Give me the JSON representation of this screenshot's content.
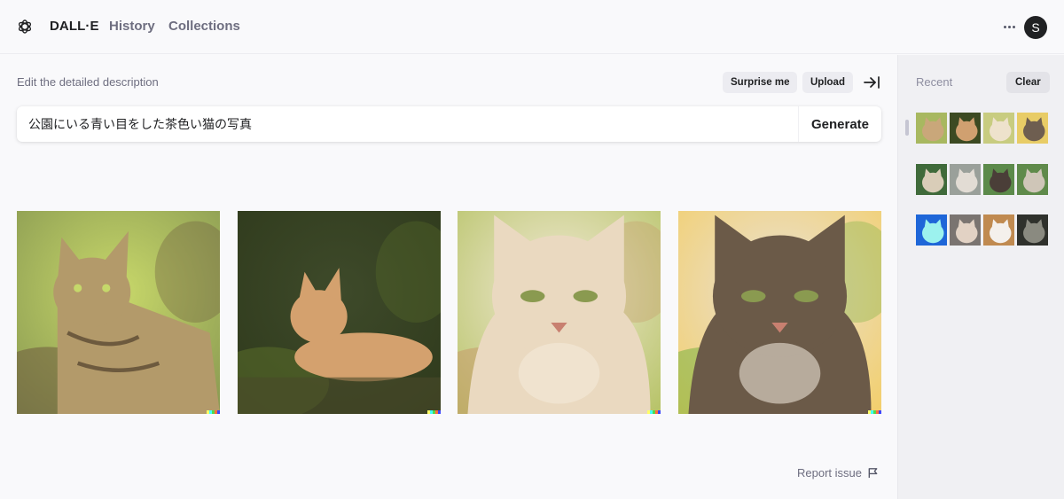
{
  "header": {
    "logo_icon": "openai-logo-icon",
    "brand": "DALL·E",
    "nav": [
      {
        "label": "History"
      },
      {
        "label": "Collections"
      }
    ],
    "more_icon": "ellipsis-icon",
    "avatar_initial": "S"
  },
  "main": {
    "instruction": "Edit the detailed description",
    "buttons": {
      "surprise": "Surprise me",
      "upload": "Upload",
      "collapse_icon": "arrow-right-to-bar-icon"
    },
    "prompt": {
      "value": "公園にいる青い目をした茶色い猫の写真",
      "generate_label": "Generate"
    },
    "images": [
      {
        "alt": "Tabby cat lying among green plants and fallen leaves",
        "palette": [
          "#8a9a52",
          "#b39a6a",
          "#6d5a3e",
          "#c8d86a"
        ]
      },
      {
        "alt": "Orange cat lying in a shaded grassy park",
        "palette": [
          "#2f3a1c",
          "#d4a16e",
          "#5a6e2a",
          "#3e4a2a"
        ]
      },
      {
        "alt": "Cream-colored cat close-up face",
        "palette": [
          "#b8c46a",
          "#ead9c0",
          "#c79a6a",
          "#f3ead8"
        ]
      },
      {
        "alt": "Brown tabby cat with green leaves and yellow background",
        "palette": [
          "#f2cf6e",
          "#6b5a48",
          "#7cb342",
          "#e9e1d6"
        ]
      }
    ],
    "watermark_colors": [
      "#ffff66",
      "#42ffff",
      "#51da4c",
      "#ff6e3c",
      "#3c46ff"
    ],
    "report_label": "Report issue",
    "report_icon": "flag-icon"
  },
  "sidebar": {
    "title": "Recent",
    "clear_label": "Clear",
    "rows": [
      {
        "thumbs": [
          {
            "palette": [
              "#a8b860",
              "#c9a77a"
            ]
          },
          {
            "palette": [
              "#3c4a22",
              "#d0a070"
            ]
          },
          {
            "palette": [
              "#c8cc80",
              "#eee2cc"
            ]
          },
          {
            "palette": [
              "#e8cc66",
              "#6e5e50"
            ]
          }
        ]
      },
      {
        "thumbs": [
          {
            "palette": [
              "#3f6a3a",
              "#d9cdb8"
            ]
          },
          {
            "palette": [
              "#9aa09a",
              "#e2dcd4"
            ]
          },
          {
            "palette": [
              "#5c8a4a",
              "#4a3e38"
            ]
          },
          {
            "palette": [
              "#5f8a4a",
              "#cfc6b8"
            ]
          }
        ]
      },
      {
        "thumbs": [
          {
            "palette": [
              "#1e66d8",
              "#9cf2ee"
            ]
          },
          {
            "palette": [
              "#7a7470",
              "#e2d2c4"
            ]
          },
          {
            "palette": [
              "#c08a50",
              "#f4f0ec"
            ]
          },
          {
            "palette": [
              "#2f312c",
              "#8a8a80"
            ]
          }
        ]
      }
    ]
  }
}
